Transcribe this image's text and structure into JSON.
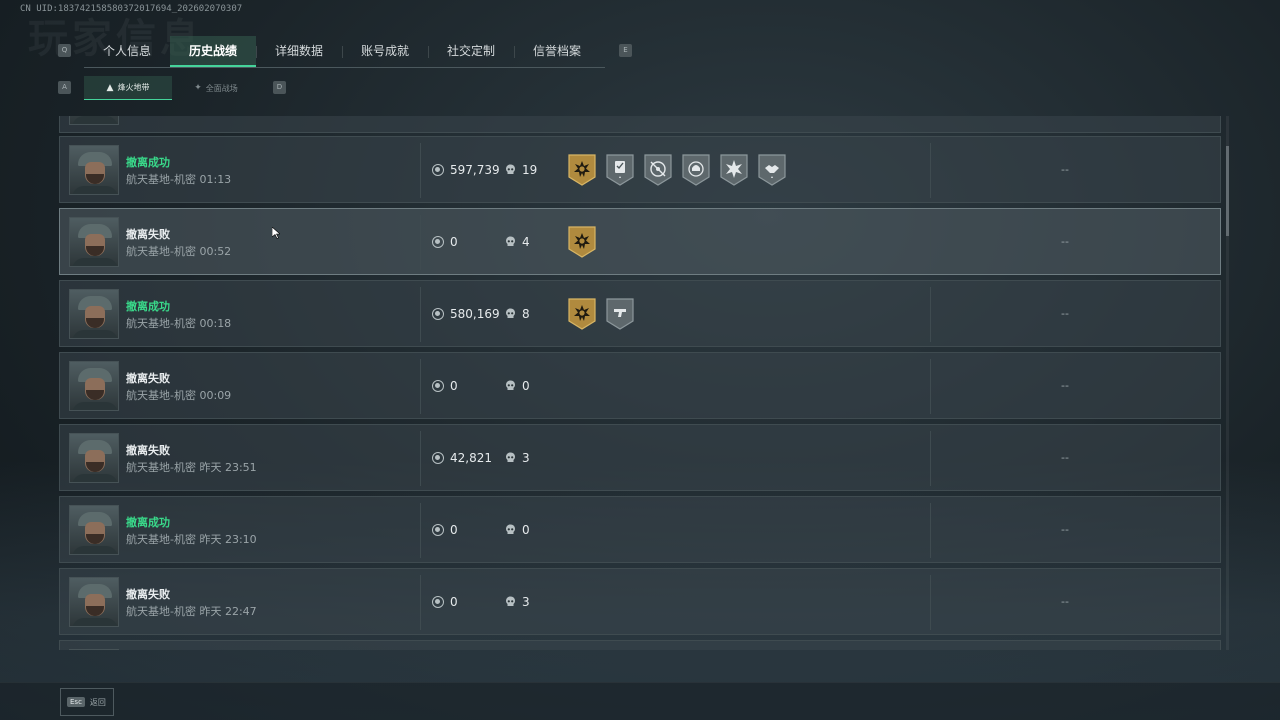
{
  "uid_text": "CN UID:18374215858037201769​4_202602070307",
  "background_title": "玩家信息",
  "key_hints": {
    "left_tab": "Q",
    "right_tab": "E",
    "left_sub": "A",
    "right_sub": "D"
  },
  "tabs": [
    {
      "label": "个人信息",
      "active": false
    },
    {
      "label": "历史战绩",
      "active": true
    },
    {
      "label": "详细数据",
      "active": false
    },
    {
      "label": "账号成就",
      "active": false
    },
    {
      "label": "社交定制",
      "active": false
    },
    {
      "label": "信誉档案",
      "active": false
    }
  ],
  "subtabs": [
    {
      "label": "烽火地带",
      "icon": "▲",
      "active": true
    },
    {
      "label": "全面战场",
      "icon": "✦",
      "active": false
    }
  ],
  "rows": [
    {
      "status": "撤离成功",
      "success": true,
      "map": "航天基地-机密",
      "time": "01:13",
      "money": "597,739",
      "kills": "19",
      "badges": [
        "gold-star",
        "card",
        "target",
        "helmet",
        "burst",
        "handshake"
      ],
      "extra": "--"
    },
    {
      "status": "撤离失败",
      "success": false,
      "map": "航天基地-机密",
      "time": "00:52",
      "money": "0",
      "kills": "4",
      "badges": [
        "gold-star"
      ],
      "extra": "--"
    },
    {
      "status": "撤离成功",
      "success": true,
      "map": "航天基地-机密",
      "time": "00:18",
      "money": "580,169",
      "kills": "8",
      "badges": [
        "gold-star",
        "gun"
      ],
      "extra": "--"
    },
    {
      "status": "撤离失败",
      "success": false,
      "map": "航天基地-机密",
      "time": "00:09",
      "money": "0",
      "kills": "0",
      "badges": [],
      "extra": "--"
    },
    {
      "status": "撤离失败",
      "success": false,
      "map": "航天基地-机密",
      "time": "昨天 23:51",
      "money": "42,821",
      "kills": "3",
      "badges": [],
      "extra": "--"
    },
    {
      "status": "撤离成功",
      "success": true,
      "map": "航天基地-机密",
      "time": "昨天 23:10",
      "money": "0",
      "kills": "0",
      "badges": [],
      "extra": "--"
    },
    {
      "status": "撤离失败",
      "success": false,
      "map": "航天基地-机密",
      "time": "昨天 22:47",
      "money": "0",
      "kills": "3",
      "badges": [],
      "extra": "--"
    }
  ],
  "footer": {
    "esc_key": "Esc",
    "back_label": "返回"
  },
  "colors": {
    "accent": "#45d49b",
    "success_text": "#39d98a",
    "gold_badge": "#b08a3e",
    "grey_badge": "#5e686c"
  }
}
